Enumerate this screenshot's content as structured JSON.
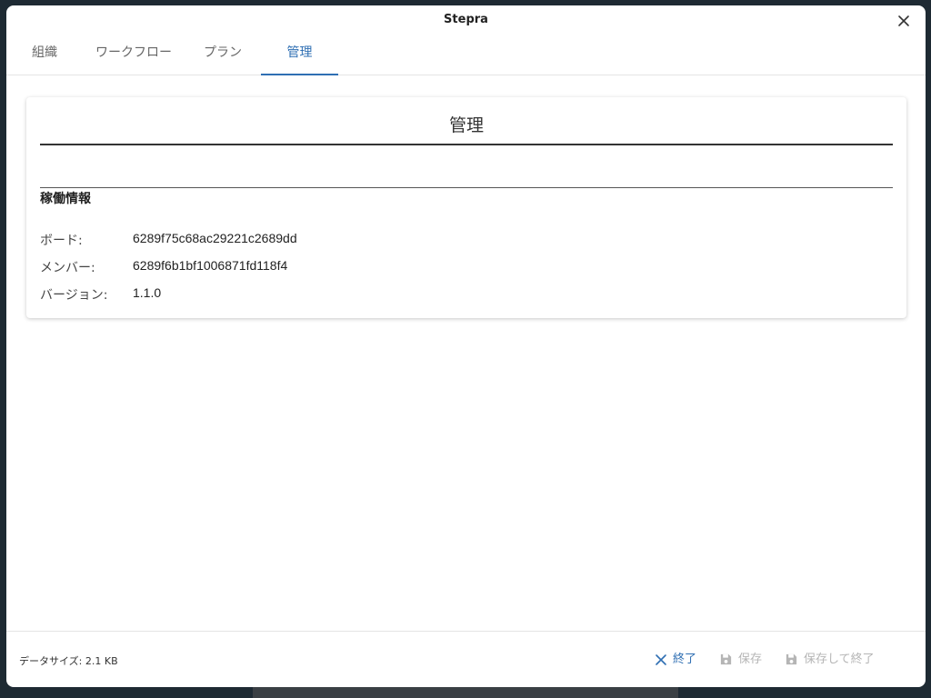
{
  "app": {
    "title": "Stepra"
  },
  "tabs": [
    {
      "label": "組織",
      "active": false
    },
    {
      "label": "ワークフロー",
      "active": false
    },
    {
      "label": "プラン",
      "active": false
    },
    {
      "label": "管理",
      "active": true
    }
  ],
  "card": {
    "title": "管理",
    "section_heading": "稼働情報",
    "rows": [
      {
        "label": "ボード:",
        "value": "6289f75c68ac29221c2689dd"
      },
      {
        "label": "メンバー:",
        "value": "6289f6b1bf1006871fd118f4"
      },
      {
        "label": "バージョン:",
        "value": "1.1.0"
      }
    ]
  },
  "footer": {
    "data_size": "データサイズ: 2.1 KB",
    "exit_label": "終了",
    "save_label": "保存",
    "save_exit_label": "保存して終了"
  },
  "icons": {
    "close": "close-icon",
    "exit": "close-icon",
    "save": "floppy-disk-icon",
    "save_exit": "floppy-disk-icon"
  },
  "colors": {
    "accent": "#2f6fb3",
    "disabled": "#b5b5b5",
    "text": "#222222"
  }
}
